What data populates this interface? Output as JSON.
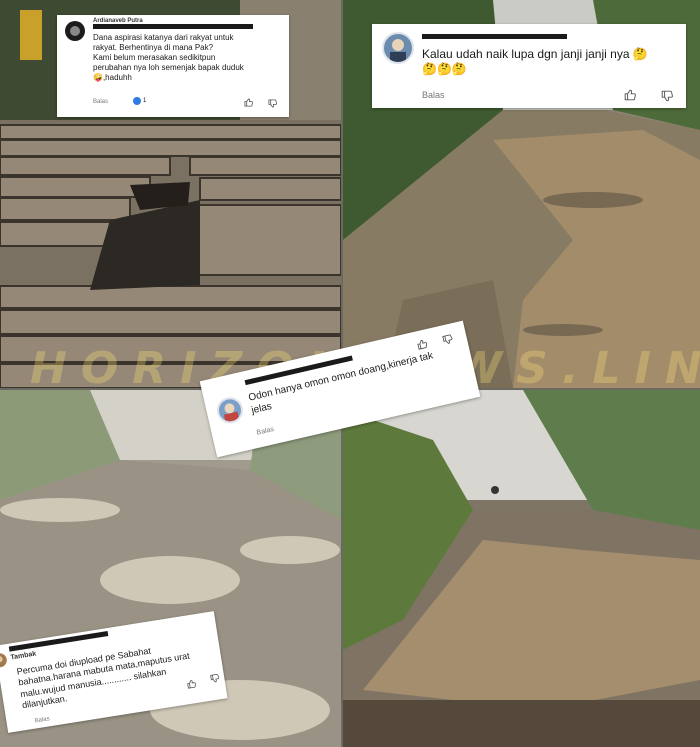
{
  "watermark": "HORIZONNEWS.LINK",
  "photos": [
    {
      "name": "broken-wooden-bridge",
      "desc_colors": {
        "wood": "#8a7a66",
        "shadow": "#2c2823"
      }
    },
    {
      "name": "muddy-road-puddles-top-right",
      "desc_colors": {
        "mud": "#8e7d62",
        "water": "#a08a6a"
      }
    },
    {
      "name": "foggy-road-potholes-bottom-left",
      "desc_colors": {
        "mud": "#9a9385",
        "water": "#c9c2b2"
      }
    },
    {
      "name": "foggy-flooded-road-bottom-right",
      "desc_colors": {
        "mud": "#7f7363",
        "water": "#a28c6d"
      }
    }
  ],
  "comments": [
    {
      "id": "comment-1",
      "username": "Ardianaveb Putra",
      "avatar_color": "#1c1c1c",
      "text_lines": [
        "Dana aspirasi katanya dari rakyat untuk",
        "rakyat. Berhentinya di mana Pak?",
        "Kami belum merasakan sedikitpun",
        "perubahan nya loh semenjak bapak duduk",
        "🤪,haduhh"
      ],
      "reply_label": "Balas",
      "like_count": "1"
    },
    {
      "id": "comment-2",
      "avatar_color": "#6b8cae",
      "text_lines": [
        "Kalau udah naik lupa dgn janji janji nya 🤔",
        "🤔🤔🤔"
      ],
      "reply_label": "Balas"
    },
    {
      "id": "comment-3",
      "avatar_color": "#7aa0c8",
      "text_lines": [
        "Odon hanya omon omon doang,kinerja tak",
        "jelas"
      ],
      "reply_label": "Balas"
    },
    {
      "id": "comment-4",
      "username": "Tambak",
      "avatar_color": "#a07b4f",
      "text_lines": [
        "Percuma doi diupload pe Sabahat",
        "bahatna.harana mabuta mata,maputus urat",
        "malu.wujud manusia............ silahkan",
        "dilanjutkan."
      ],
      "reply_label": "Balas"
    }
  ]
}
